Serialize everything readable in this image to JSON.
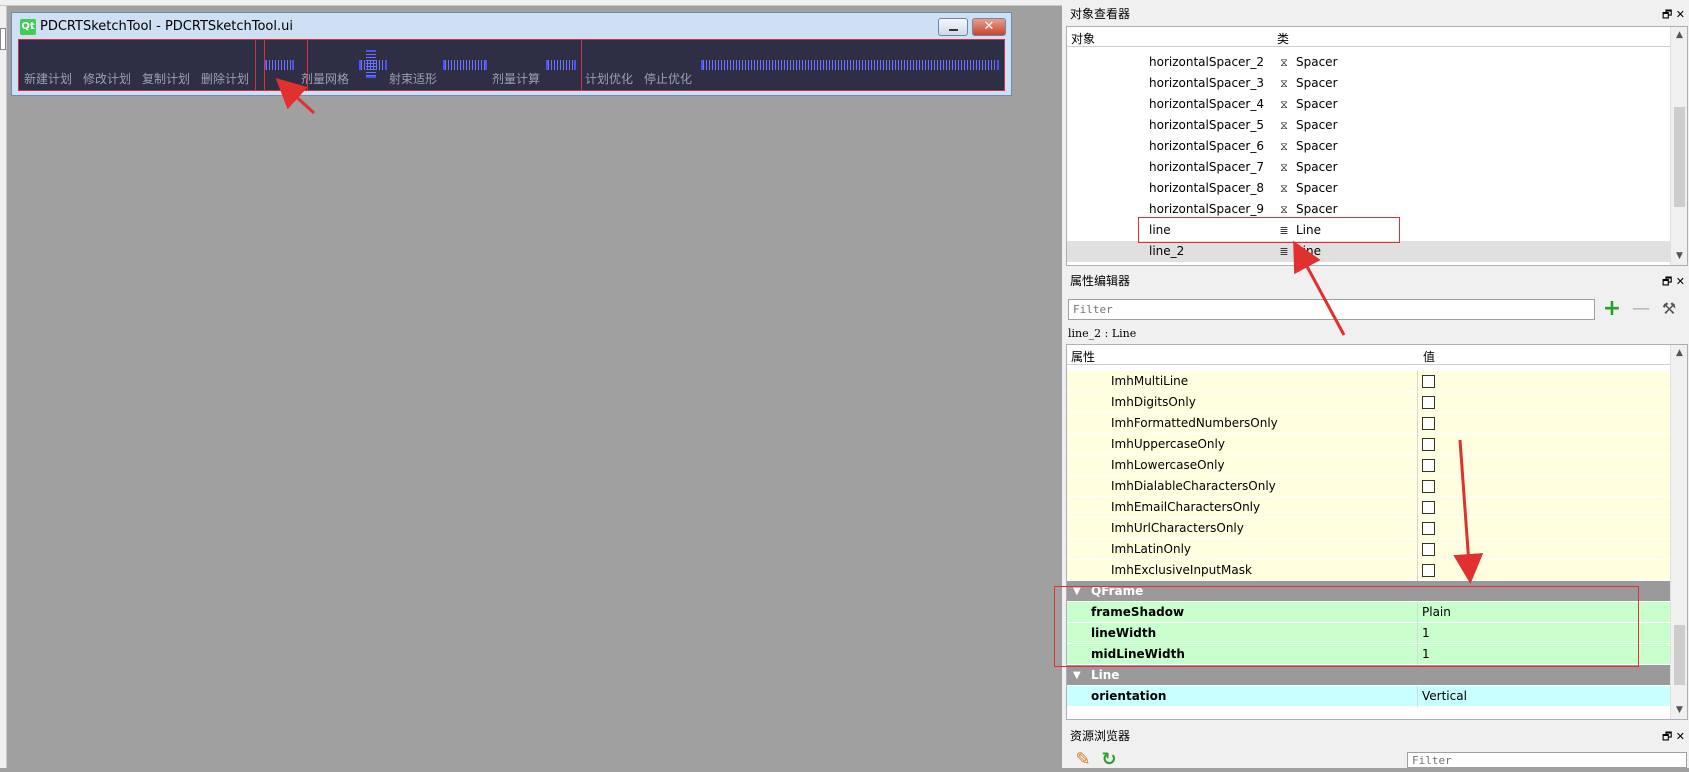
{
  "form": {
    "title": "PDCRTSketchTool - PDCRTSketchTool.ui",
    "logo": "Qt",
    "close_glyph": "✕",
    "toolbar_labels": [
      "新建计划",
      "修改计划",
      "复制计划",
      "删除计划",
      "剂量网格",
      "射束适形",
      "剂量计算",
      "计划优化",
      "停止优化"
    ]
  },
  "object_inspector": {
    "title": "对象查看器",
    "col_object": "对象",
    "col_class": "类",
    "rows": [
      {
        "name": "horizontalSpacer_2",
        "cls": "Spacer",
        "icon": "spacer-icon"
      },
      {
        "name": "horizontalSpacer_3",
        "cls": "Spacer",
        "icon": "spacer-icon"
      },
      {
        "name": "horizontalSpacer_4",
        "cls": "Spacer",
        "icon": "spacer-icon"
      },
      {
        "name": "horizontalSpacer_5",
        "cls": "Spacer",
        "icon": "spacer-icon"
      },
      {
        "name": "horizontalSpacer_6",
        "cls": "Spacer",
        "icon": "spacer-icon"
      },
      {
        "name": "horizontalSpacer_7",
        "cls": "Spacer",
        "icon": "spacer-icon"
      },
      {
        "name": "horizontalSpacer_8",
        "cls": "Spacer",
        "icon": "spacer-icon"
      },
      {
        "name": "horizontalSpacer_9",
        "cls": "Spacer",
        "icon": "spacer-icon"
      },
      {
        "name": "line",
        "cls": "Line",
        "icon": "line-icon"
      },
      {
        "name": "line_2",
        "cls": "Line",
        "icon": "line-icon"
      }
    ]
  },
  "property_editor": {
    "title": "属性编辑器",
    "filter_placeholder": "Filter",
    "object_info": "line_2 : Line",
    "col_property": "属性",
    "col_value": "值",
    "flag_rows": [
      "ImhMultiLine",
      "ImhDigitsOnly",
      "ImhFormattedNumbersOnly",
      "ImhUppercaseOnly",
      "ImhLowercaseOnly",
      "ImhDialableCharactersOnly",
      "ImhEmailCharactersOnly",
      "ImhUrlCharactersOnly",
      "ImhLatinOnly",
      "ImhExclusiveInputMask"
    ],
    "group_qframe": "QFrame",
    "qframe_props": [
      {
        "name": "frameShadow",
        "value": "Plain"
      },
      {
        "name": "lineWidth",
        "value": "1"
      },
      {
        "name": "midLineWidth",
        "value": "1"
      }
    ],
    "group_line": "Line",
    "line_props": [
      {
        "name": "orientation",
        "value": "Vertical"
      }
    ]
  },
  "resource_browser": {
    "title": "资源浏览器",
    "filter_placeholder": "Filter"
  },
  "dock_buttons": "🗗 ✕",
  "colors": {
    "annotation_red": "#e03030",
    "designer_bg": "#a0a0a0",
    "toolbar_bg": "#2e2e44",
    "qframe_green": "#c8ffcc",
    "line_cyan": "#c8ffff",
    "flag_yellow": "#ffffe0"
  }
}
